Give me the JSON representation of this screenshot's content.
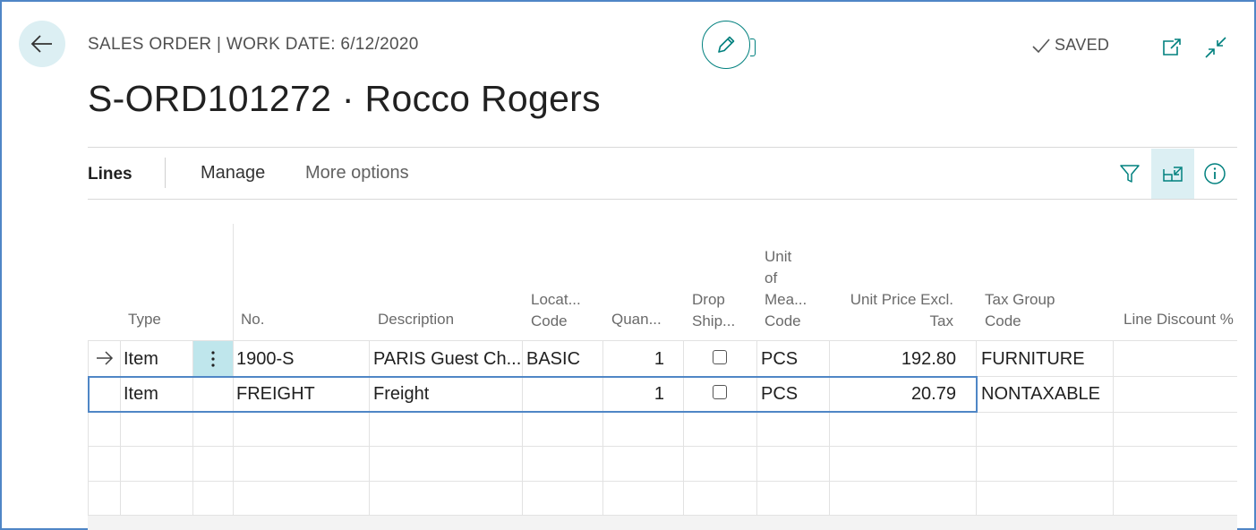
{
  "header": {
    "breadcrumb": "SALES ORDER | WORK DATE: 6/12/2020",
    "saved_label": "SAVED",
    "title": "S-ORD101272 · Rocco Rogers"
  },
  "icons": {
    "back": "arrow-left-icon",
    "edit": "pencil-icon",
    "saved": "checkmark-icon",
    "open_new": "open-in-new-window-icon",
    "collapse": "collapse-icon",
    "filter": "filter-icon",
    "focus": "focus-mode-icon",
    "info": "info-icon",
    "row_menu": "vertical-ellipsis-icon",
    "current_row": "arrow-right-icon"
  },
  "colors": {
    "accent": "#00807e",
    "selection_border": "#4f86c6",
    "active_highlight": "#bfe6ec"
  },
  "tabs": {
    "lines": "Lines",
    "manage": "Manage",
    "more": "More options"
  },
  "columns": {
    "type": "Type",
    "no": "No.",
    "description": "Description",
    "location_1": "Locat...",
    "location_2": "Code",
    "quantity": "Quan...",
    "drop_1": "Drop",
    "drop_2": "Ship...",
    "uom_1": "Unit",
    "uom_2": "of",
    "uom_3": "Mea...",
    "uom_4": "Code",
    "price_1": "Unit Price Excl.",
    "price_2": "Tax",
    "taxgroup_1": "Tax Group",
    "taxgroup_2": "Code",
    "discount": "Line Discount %"
  },
  "rows": [
    {
      "type": "Item",
      "no": "1900-S",
      "description": "PARIS Guest Ch...",
      "location": "BASIC",
      "quantity": "1",
      "drop_ship": false,
      "uom": "PCS",
      "unit_price": "192.80",
      "tax_group": "FURNITURE",
      "line_discount": ""
    },
    {
      "type": "Item",
      "no": "FREIGHT",
      "description": "Freight",
      "location": "",
      "quantity": "1",
      "drop_ship": false,
      "uom": "PCS",
      "unit_price": "20.79",
      "tax_group": "NONTAXABLE",
      "line_discount": ""
    }
  ]
}
